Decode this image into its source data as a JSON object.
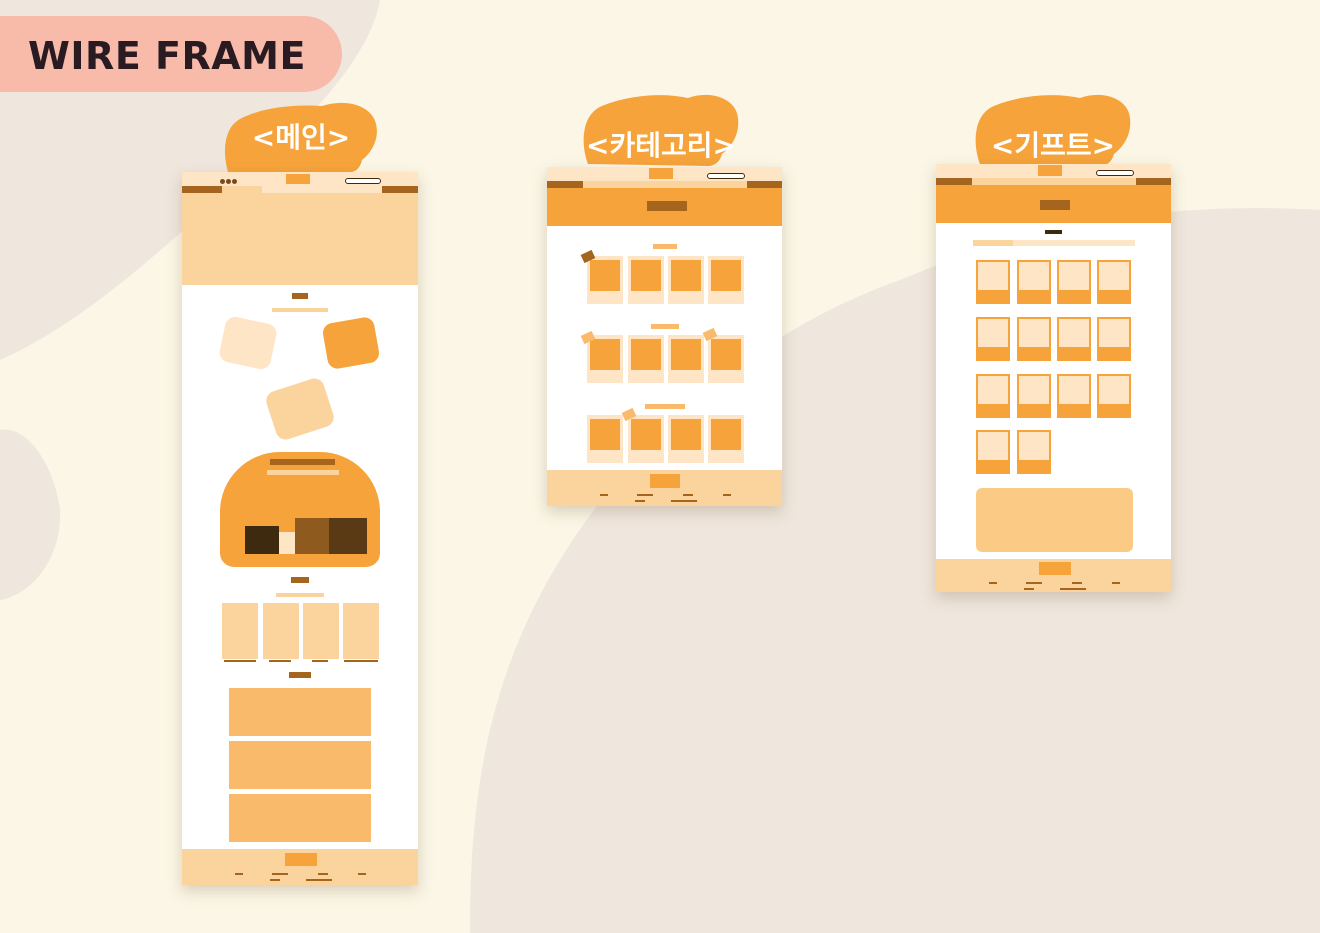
{
  "header": {
    "title": "WIRE FRAME"
  },
  "frames": [
    {
      "id": "main",
      "label": "<메인>"
    },
    {
      "id": "category",
      "label": "<카테고리>"
    },
    {
      "id": "gift",
      "label": "<기프트>"
    }
  ],
  "icons": {
    "window_controls": "window-dots-icon",
    "search": "search-bar-icon"
  },
  "colors": {
    "background": "#fbf6e6",
    "blob": "#efe6dd",
    "title_pill": "#f8bba9",
    "title_text": "#2a1a22",
    "accent_orange": "#f6a33b",
    "light_orange": "#fbd39c",
    "pale_orange": "#fde5c6",
    "brown": "#a5651e",
    "dark_brown": "#3d2a0f"
  }
}
